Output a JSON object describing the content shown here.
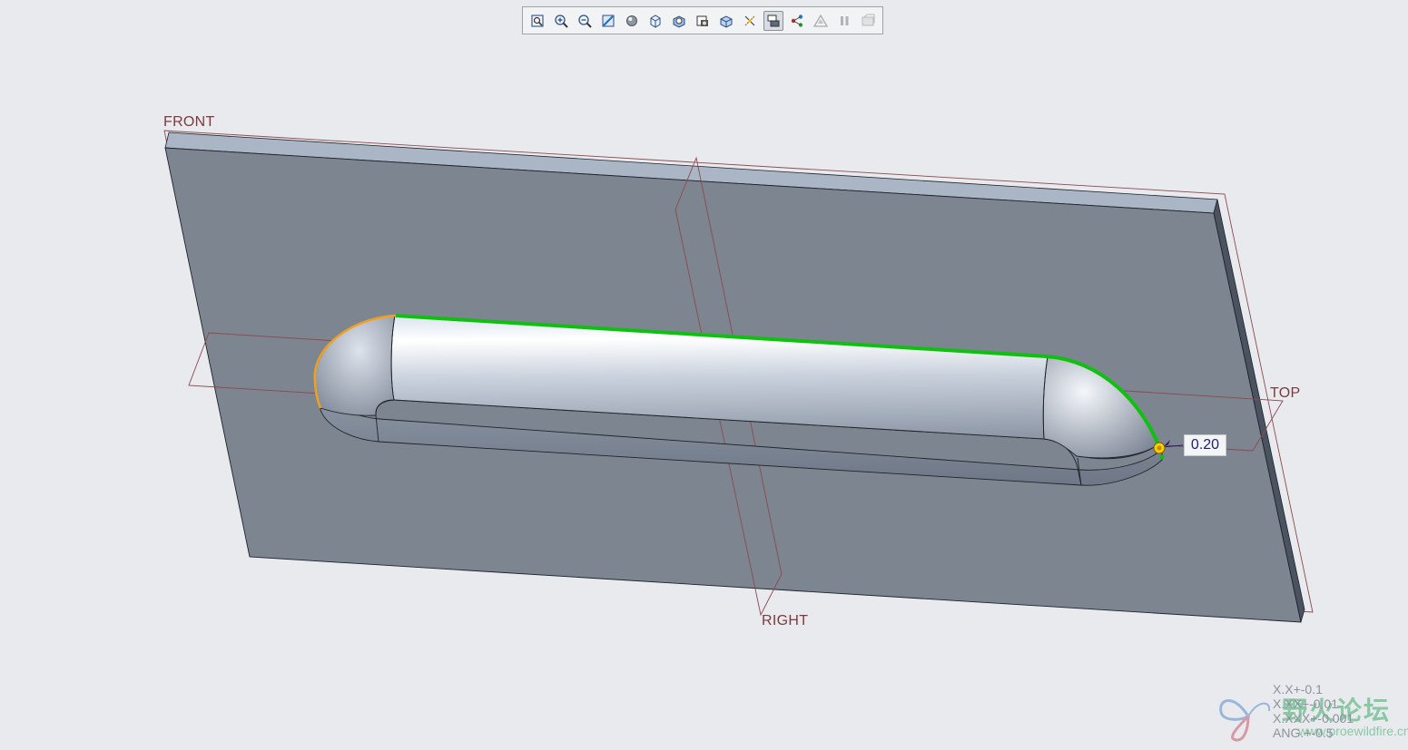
{
  "toolbar": {
    "buttons": [
      {
        "name": "refit-icon",
        "active": false
      },
      {
        "name": "zoom-in-icon",
        "active": false
      },
      {
        "name": "zoom-out-icon",
        "active": false
      },
      {
        "name": "repaint-icon",
        "active": false
      },
      {
        "name": "display-style-icon",
        "active": false
      },
      {
        "name": "saved-orientations-icon",
        "active": false
      },
      {
        "name": "view-manager-icon",
        "active": false
      },
      {
        "name": "perspective-view-icon",
        "active": false
      },
      {
        "name": "spin-center-icon",
        "active": false
      },
      {
        "name": "datum-display-icon",
        "active": false
      },
      {
        "name": "annotation-display-icon",
        "active": true
      },
      {
        "name": "feature-connection-icon",
        "active": false
      },
      {
        "name": "verify-icon",
        "active": false
      },
      {
        "name": "pause-icon",
        "active": false
      },
      {
        "name": "preview-icon",
        "active": false
      }
    ]
  },
  "datum_planes": {
    "front": "FRONT",
    "top": "TOP",
    "right": "RIGHT"
  },
  "dimension": {
    "value": "0.20"
  },
  "tolerances": [
    "X.X+-0.1",
    "X.XX+-0.01",
    "X.XXX+-0.001",
    "ANG.+-0.5"
  ],
  "watermark": {
    "title": "野火论坛",
    "url": "www.proewildfire.cn"
  },
  "colors": {
    "background": "#e8eaee",
    "part_face": "#7d8591",
    "selected_edge": "#10c010",
    "highlight_edge": "#f0a020",
    "datum": "#7a3b3f"
  }
}
